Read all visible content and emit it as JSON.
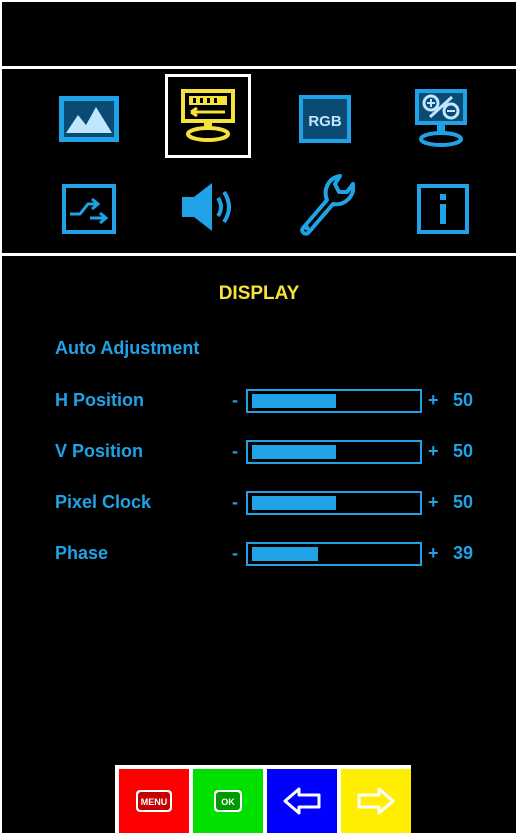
{
  "menu": {
    "title": "DISPLAY",
    "colors": {
      "label": "#1fa3e6",
      "title": "#f5e23a",
      "selected_icon": "#f5e23a"
    },
    "icons": [
      {
        "name": "picture-icon"
      },
      {
        "name": "display-icon",
        "selected": true
      },
      {
        "name": "rgb-icon",
        "text": "RGB"
      },
      {
        "name": "osd-settings-icon"
      },
      {
        "name": "input-source-icon"
      },
      {
        "name": "audio-icon"
      },
      {
        "name": "setup-wrench-icon"
      },
      {
        "name": "information-icon"
      }
    ],
    "auto_adjustment": "Auto Adjustment",
    "sliders": [
      {
        "label": "H Position",
        "minus": "-",
        "plus": "+",
        "value": "50",
        "level": 0.5
      },
      {
        "label": "V Position",
        "minus": "-",
        "plus": "+",
        "value": "50",
        "level": 0.5
      },
      {
        "label": "Pixel Clock",
        "minus": "-",
        "plus": "+",
        "value": "50",
        "level": 0.5
      },
      {
        "label": "Phase",
        "minus": "-",
        "plus": "+",
        "value": "39",
        "level": 0.39
      }
    ]
  },
  "buttons": [
    {
      "name": "menu-button",
      "label": "MENU",
      "color": "#ff0000"
    },
    {
      "name": "ok-button",
      "label": "OK",
      "color": "#00e000"
    },
    {
      "name": "left-arrow-button",
      "color": "#0000ff"
    },
    {
      "name": "right-arrow-button",
      "color": "#ffee00"
    }
  ]
}
